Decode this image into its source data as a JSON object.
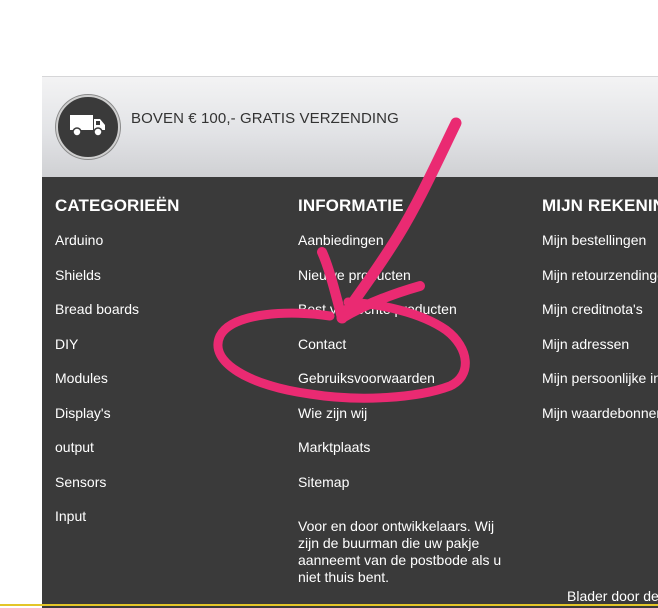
{
  "banner": {
    "text": "BOVEN € 100,- GRATIS VERZENDING",
    "icon": "truck-icon"
  },
  "columns": [
    {
      "title": "CATEGORIEËN",
      "items": [
        "Arduino",
        "Shields",
        "Bread boards",
        "DIY",
        "Modules",
        "Display's",
        "output",
        "Sensors",
        "Input"
      ]
    },
    {
      "title": "INFORMATIE",
      "items": [
        "Aanbiedingen",
        "Nieuwe producten",
        "Best verkochte producten",
        "Contact",
        "Gebruiksvoorwaarden",
        "Wie zijn wij",
        "Marktplaats",
        "Sitemap"
      ],
      "about": "Voor en door ontwikkelaars. Wij zijn de buurman die uw pakje aanneemt van de postbode als u niet thuis bent."
    },
    {
      "title": "MIJN REKENING",
      "items": [
        "Mijn bestellingen",
        "Mijn retourzendingen",
        "Mijn creditnota's",
        "Mijn adressen",
        "Mijn persoonlijke info",
        "Mijn waardebonnen"
      ]
    }
  ],
  "footer": {
    "browse_text": "Blader door de"
  },
  "colors": {
    "footer_bg": "#3a3a3a",
    "annotation": "#ea2a72",
    "bottom_accent": "#e3c628"
  }
}
